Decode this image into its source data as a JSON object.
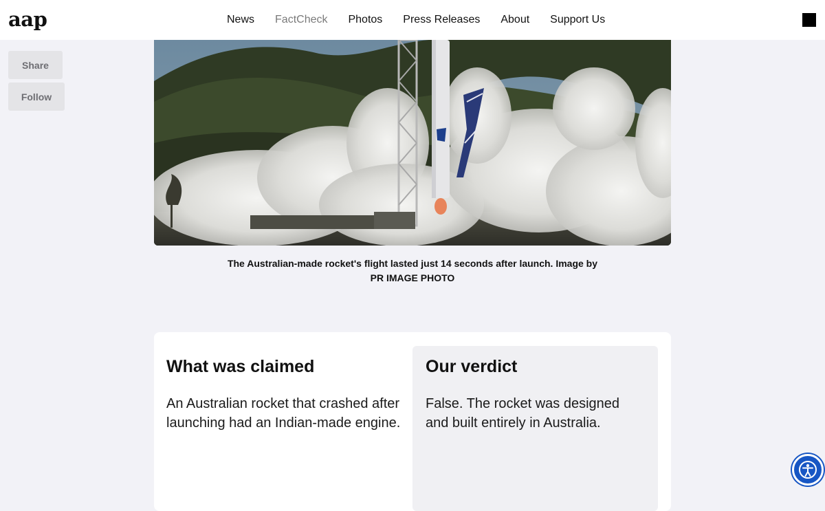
{
  "header": {
    "logo": "aap",
    "nav": [
      {
        "label": "News"
      },
      {
        "label": "FactCheck",
        "active": true
      },
      {
        "label": "Photos"
      },
      {
        "label": "Press Releases"
      },
      {
        "label": "About"
      },
      {
        "label": "Support Us"
      }
    ],
    "menu_icon": "menu-square-icon"
  },
  "rail": {
    "share_label": "Share",
    "follow_label": "Follow"
  },
  "hero": {
    "caption": "The Australian-made rocket's flight lasted just 14 seconds after launch. Image by PR IMAGE PHOTO"
  },
  "claim_card": {
    "claim_heading": "What was claimed",
    "claim_text": "An Australian rocket that crashed after launching had an Indian-made engine.",
    "verdict_heading": "Our verdict",
    "verdict_text": "False. The rocket was designed and built entirely in Australia."
  },
  "accessibility": {
    "icon": "accessibility-icon"
  },
  "colors": {
    "background": "#f2f2f7",
    "header": "#ffffff",
    "active_nav": "#7a7a7a",
    "accessibility_blue": "#1756c4"
  }
}
